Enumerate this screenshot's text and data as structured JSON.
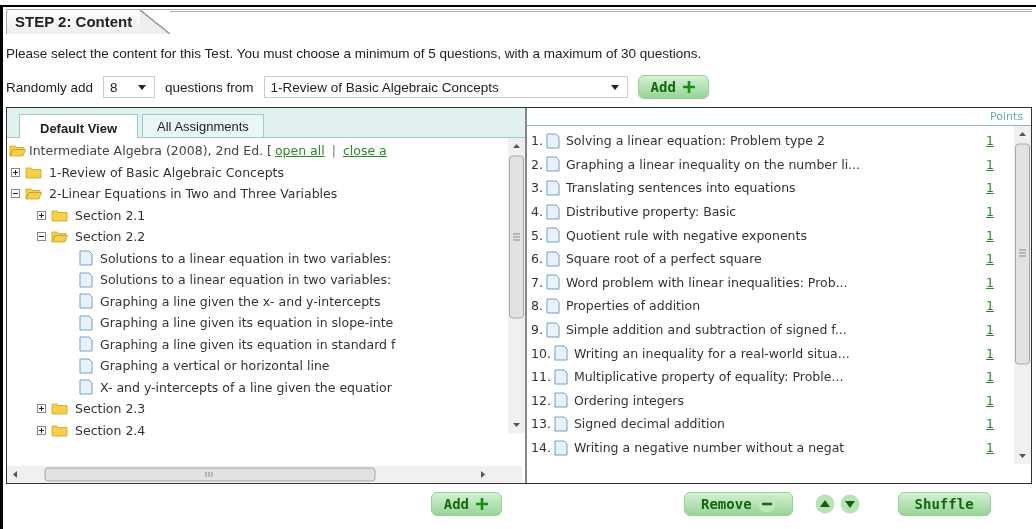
{
  "step_title": "STEP 2: Content",
  "instructions": "Please select the content for this Test. You must choose a minimum of 5 questions, with a maximum of 30 questions.",
  "random_add": {
    "label_before": "Randomly add",
    "count": "8",
    "label_middle": "questions from",
    "source": "1-Review of Basic Algebraic Concepts",
    "button": "Add"
  },
  "tabs": [
    {
      "label": "Default View",
      "selected": true
    },
    {
      "label": "All Assignments",
      "selected": false
    }
  ],
  "tree": {
    "root": {
      "label": "Intermediate Algebra (2008), 2nd Ed. [",
      "expanded": true,
      "links": [
        "open all",
        "close a"
      ],
      "separator": "|"
    },
    "children": [
      {
        "kind": "folder",
        "label": "1-Review of Basic Algebraic Concepts",
        "expanded": false
      },
      {
        "kind": "folder",
        "label": "2-Linear Equations in Two and Three Variables",
        "expanded": true,
        "children": [
          {
            "kind": "folder",
            "label": "Section 2.1",
            "expanded": false
          },
          {
            "kind": "folder",
            "label": "Section 2.2",
            "expanded": true,
            "children": [
              {
                "kind": "document",
                "label": "Solutions to a linear equation in two variables:"
              },
              {
                "kind": "document",
                "label": "Solutions to a linear equation in two variables:"
              },
              {
                "kind": "document",
                "label": "Graphing a line given the x- and y-intercepts"
              },
              {
                "kind": "document",
                "label": "Graphing a line given its equation in slope-inte"
              },
              {
                "kind": "document",
                "label": "Graphing a line given its equation in standard f"
              },
              {
                "kind": "document",
                "label": "Graphing a vertical or horizontal line"
              },
              {
                "kind": "document",
                "label": "X- and y-intercepts of a line given the equatior"
              }
            ]
          },
          {
            "kind": "folder",
            "label": "Section 2.3",
            "expanded": false
          },
          {
            "kind": "folder",
            "label": "Section 2.4",
            "expanded": false
          }
        ]
      }
    ]
  },
  "questions_header": "Points",
  "questions": [
    {
      "number": "1.",
      "title": "Solving a linear equation: Problem type 2",
      "points": "1"
    },
    {
      "number": "2.",
      "title": "Graphing a linear inequality on the number li...",
      "points": "1"
    },
    {
      "number": "3.",
      "title": "Translating sentences into equations",
      "points": "1"
    },
    {
      "number": "4.",
      "title": "Distributive property: Basic",
      "points": "1"
    },
    {
      "number": "5.",
      "title": "Quotient rule with negative exponents",
      "points": "1"
    },
    {
      "number": "6.",
      "title": "Square root of a perfect square",
      "points": "1"
    },
    {
      "number": "7.",
      "title": "Word problem with linear inequalities: Prob...",
      "points": "1"
    },
    {
      "number": "8.",
      "title": "Properties of addition",
      "points": "1"
    },
    {
      "number": "9.",
      "title": "Simple addition and subtraction of signed f...",
      "points": "1"
    },
    {
      "number": "10.",
      "title": "Writing an inequality for a real-world situa...",
      "points": "1"
    },
    {
      "number": "11.",
      "title": "Multiplicative property of equality: Proble...",
      "points": "1"
    },
    {
      "number": "12.",
      "title": "Ordering integers",
      "points": "1"
    },
    {
      "number": "13.",
      "title": "Signed decimal addition",
      "points": "1"
    },
    {
      "number": "14.",
      "title": "Writing a negative number without a negat",
      "points": "1"
    }
  ],
  "bottom_buttons": {
    "add": "Add",
    "remove": "Remove",
    "shuffle": "Shuffle"
  }
}
